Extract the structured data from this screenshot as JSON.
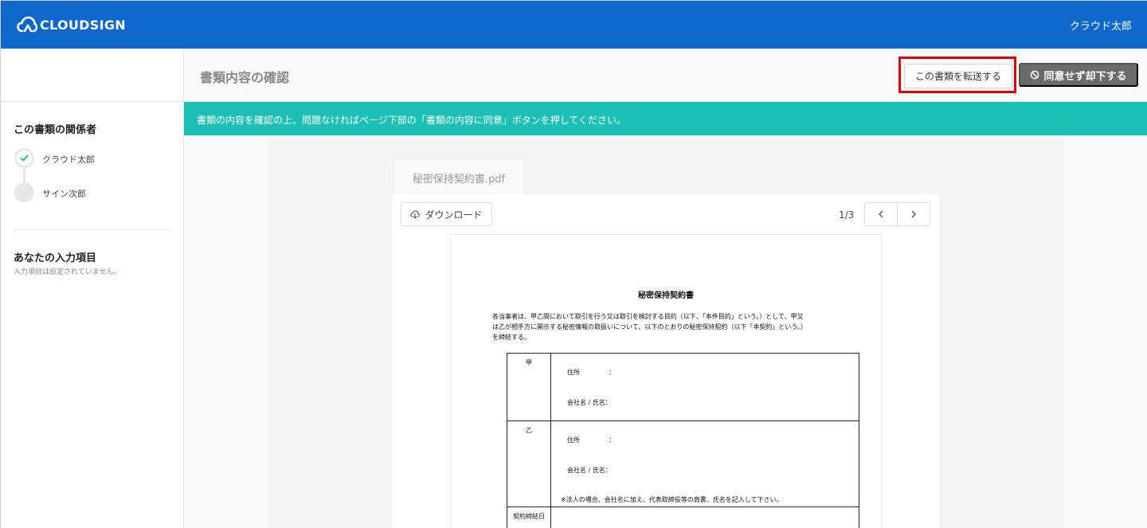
{
  "header": {
    "logo_text": "CLOUDSIGN",
    "user_name": "クラウド太郎"
  },
  "toolbar": {
    "title": "書類内容の確認",
    "forward_label": "この書類を転送する",
    "reject_label": "同意せず却下する"
  },
  "notice": "書類の内容を確認の上、問題なければページ下部の「書類の内容に同意」ボタンを押してください。",
  "sidebar": {
    "parties_title": "この書類の関係者",
    "parties": [
      {
        "name": "クラウド太郎",
        "status": "done"
      },
      {
        "name": "サイン次郎",
        "status": "pending"
      }
    ],
    "inputs_title": "あなたの入力項目",
    "inputs_note": "入力項目は設定されていません。"
  },
  "viewer": {
    "file_tab": "秘密保持契約書.pdf",
    "download_label": "ダウンロード",
    "page_indicator": "1/3"
  },
  "pdf": {
    "title": "秘密保持契約書",
    "paragraph": "各当事者は、甲乙間において取引を行う又は取引を検討する目的（以下、「本件目的」という。）として、甲又\nは乙が相手方に開示する秘密情報の取扱いについて、以下のとおりの秘密保持契約（以下「本契約」という。）\nを締結する。",
    "party_a": "甲",
    "party_b": "乙",
    "address_label": "住所",
    "colon": "：",
    "company_label": "会社名 / 氏名：",
    "note": "※法人の場合、会社名に加え、代表取締役等の肩書、氏名を記入して下さい。",
    "contract_date": "契約締結日"
  },
  "colors": {
    "brand": "#0e68cb",
    "notice": "#1cc0b5",
    "reject": "#6b6b6b",
    "highlight": "#e00000"
  }
}
